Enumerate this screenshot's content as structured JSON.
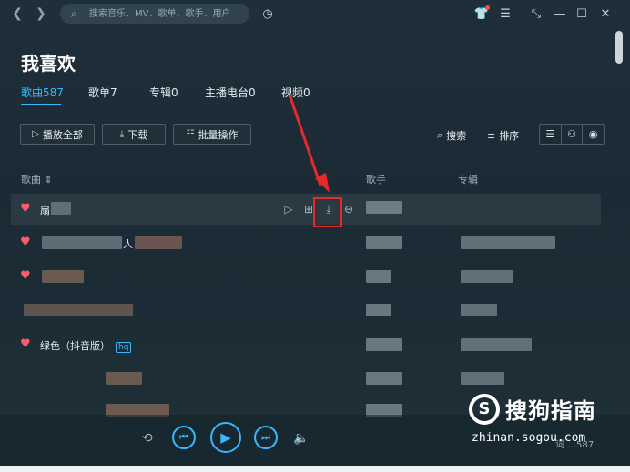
{
  "titlebar": {
    "search_placeholder": "搜索音乐、MV、歌单、歌手、用户"
  },
  "header": {
    "title": "我喜欢",
    "tabs": [
      "歌曲587",
      "歌单7",
      "专辑0",
      "主播电台0",
      "视频0"
    ]
  },
  "toolbar": {
    "play_all": "播放全部",
    "download": "下载",
    "batch": "批量操作",
    "search": "搜索",
    "sort": "排序"
  },
  "columns": {
    "song": "歌曲",
    "artist": "歌手",
    "album": "专辑"
  },
  "songs": [
    {
      "title": "扇",
      "tag": ""
    },
    {
      "title": "人",
      "tag": ""
    },
    {
      "title": "",
      "tag": ""
    },
    {
      "title": "",
      "tag": ""
    },
    {
      "title": "绿色（抖音版）",
      "tag": "hq"
    },
    {
      "title": "",
      "tag": ""
    },
    {
      "title": "",
      "tag": ""
    }
  ],
  "player": {
    "status_text": "词  …587"
  },
  "watermark": {
    "brand": "搜狗指南",
    "url": "zhinan.sogou.com",
    "logo_letter": "S"
  },
  "colors": {
    "accent": "#39b8ff",
    "heart": "#ff5a6a",
    "highlight": "#e8282a"
  }
}
